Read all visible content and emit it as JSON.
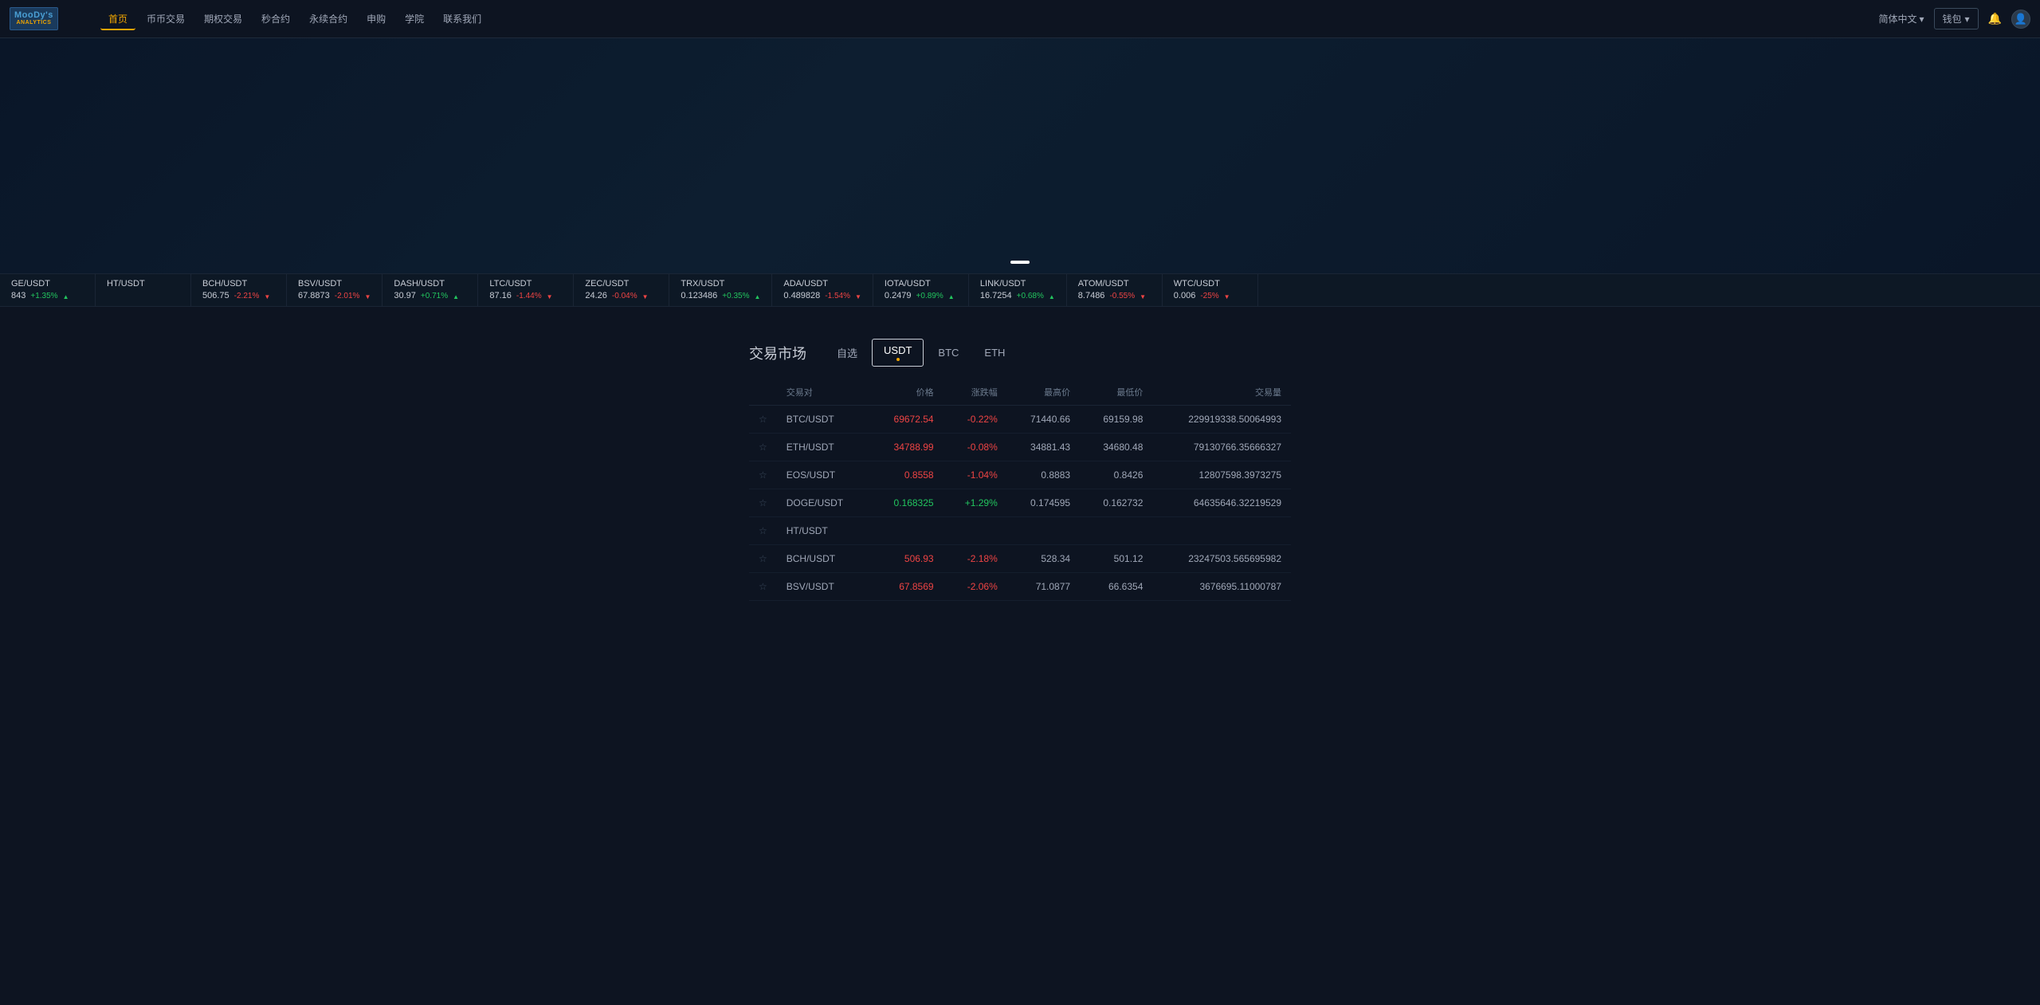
{
  "app": {
    "name": "MooDy",
    "tagline": "$ ANALYTICS"
  },
  "header": {
    "logo_line1": "MooDy's",
    "logo_line2": "ANALYTICS",
    "nav_items": [
      {
        "label": "首页",
        "active": true
      },
      {
        "label": "币币交易",
        "active": false
      },
      {
        "label": "期权交易",
        "active": false
      },
      {
        "label": "秒合约",
        "active": false
      },
      {
        "label": "永续合约",
        "active": false
      },
      {
        "label": "申购",
        "active": false
      },
      {
        "label": "学院",
        "active": false
      },
      {
        "label": "联系我们",
        "active": false
      }
    ],
    "lang": "简体中文",
    "wallet": "钱包"
  },
  "ticker": [
    {
      "pair": "GE/USDT",
      "price": "843",
      "change": "+1.35%",
      "direction": "up"
    },
    {
      "pair": "HT/USDT",
      "price": "",
      "change": "",
      "direction": "up"
    },
    {
      "pair": "BCH/USDT",
      "price": "506.75",
      "change": "-2.21%",
      "direction": "down"
    },
    {
      "pair": "BSV/USDT",
      "price": "67.8873",
      "change": "-2.01%",
      "direction": "down"
    },
    {
      "pair": "DASH/USDT",
      "price": "30.97",
      "change": "+0.71%",
      "direction": "up"
    },
    {
      "pair": "LTC/USDT",
      "price": "87.16",
      "change": "-1.44%",
      "direction": "down"
    },
    {
      "pair": "ZEC/USDT",
      "price": "24.26",
      "change": "-0.04%",
      "direction": "down"
    },
    {
      "pair": "TRX/USDT",
      "price": "0.123486",
      "change": "+0.35%",
      "direction": "up"
    },
    {
      "pair": "ADA/USDT",
      "price": "0.489828",
      "change": "-1.54%",
      "direction": "down"
    },
    {
      "pair": "IOTA/USDT",
      "price": "0.2479",
      "change": "+0.89%",
      "direction": "up"
    },
    {
      "pair": "LINK/USDT",
      "price": "16.7254",
      "change": "+0.68%",
      "direction": "up"
    },
    {
      "pair": "ATOM/USDT",
      "price": "8.7486",
      "change": "-0.55%",
      "direction": "down"
    },
    {
      "pair": "WTC/USDT",
      "price": "0.006",
      "change": "-25%",
      "direction": "down"
    }
  ],
  "market": {
    "title": "交易市场",
    "tabs": [
      {
        "label": "自选",
        "active": false
      },
      {
        "label": "USDT",
        "active": true
      },
      {
        "label": "BTC",
        "active": false
      },
      {
        "label": "ETH",
        "active": false
      }
    ],
    "columns": [
      "交易对",
      "价格",
      "涨跌幅",
      "最高价",
      "最低价",
      "交易量"
    ],
    "rows": [
      {
        "pair": "BTC/USDT",
        "price": "69672.54",
        "price_color": "neg",
        "change": "-0.22%",
        "change_color": "neg",
        "high": "71440.66",
        "low": "69159.98",
        "volume": "229919338.50064993"
      },
      {
        "pair": "ETH/USDT",
        "price": "34788.99",
        "price_color": "neg",
        "change": "-0.08%",
        "change_color": "neg",
        "high": "34881.43",
        "low": "34680.48",
        "volume": "79130766.35666327"
      },
      {
        "pair": "EOS/USDT",
        "price": "0.8558",
        "price_color": "neg",
        "change": "-1.04%",
        "change_color": "neg",
        "high": "0.8883",
        "low": "0.8426",
        "volume": "12807598.3973275"
      },
      {
        "pair": "DOGE/USDT",
        "price": "0.168325",
        "price_color": "pos",
        "change": "+1.29%",
        "change_color": "pos",
        "high": "0.174595",
        "low": "0.162732",
        "volume": "64635646.32219529"
      },
      {
        "pair": "HT/USDT",
        "price": "",
        "price_color": "neg",
        "change": "",
        "change_color": "neg",
        "high": "",
        "low": "",
        "volume": ""
      },
      {
        "pair": "BCH/USDT",
        "price": "506.93",
        "price_color": "neg",
        "change": "-2.18%",
        "change_color": "neg",
        "high": "528.34",
        "low": "501.12",
        "volume": "23247503.565695982"
      },
      {
        "pair": "BSV/USDT",
        "price": "67.8569",
        "price_color": "neg",
        "change": "-2.06%",
        "change_color": "neg",
        "high": "71.0877",
        "low": "66.6354",
        "volume": "3676695.11000787"
      }
    ]
  }
}
